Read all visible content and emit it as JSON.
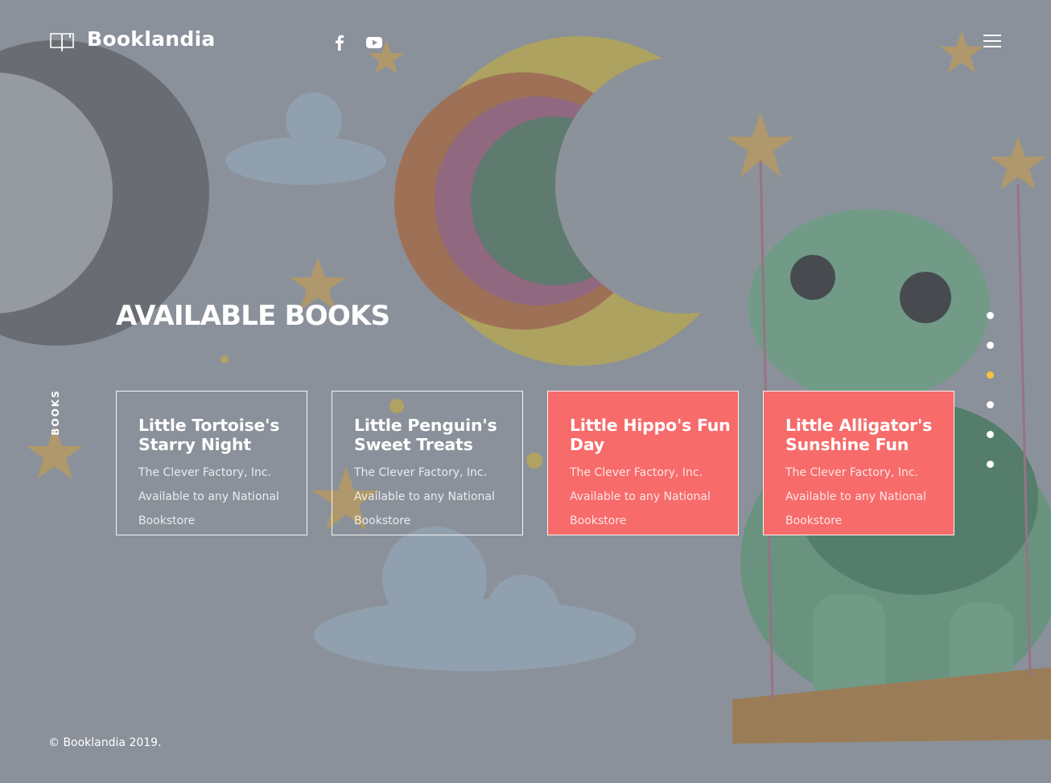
{
  "brand": {
    "name": "Booklandia",
    "icon": "open-book-icon"
  },
  "social": [
    {
      "name": "facebook",
      "icon": "facebook-icon"
    },
    {
      "name": "youtube",
      "icon": "youtube-icon"
    }
  ],
  "menu": {
    "icon": "hamburger-menu-icon"
  },
  "section": {
    "side_label": "BOOKS",
    "title": "AVAILABLE BOOKS"
  },
  "books": [
    {
      "title": "Little Tortoise's Starry Night",
      "publisher": "The Clever Factory, Inc.",
      "availability": "Available to any National Bookstore",
      "highlighted": false
    },
    {
      "title": "Little Penguin's Sweet Treats",
      "publisher": "The Clever Factory, Inc.",
      "availability": "Available to any National Bookstore",
      "highlighted": false
    },
    {
      "title": "Little Hippo's Fun Day",
      "publisher": "The Clever Factory, Inc.",
      "availability": "Available to any National Bookstore",
      "highlighted": true
    },
    {
      "title": "Little Alligator's Sunshine Fun",
      "publisher": "The Clever Factory, Inc.",
      "availability": "Available to any National Bookstore",
      "highlighted": true
    }
  ],
  "pagination": {
    "count": 6,
    "active_index": 2,
    "active_color": "#f7c23e"
  },
  "footer": {
    "copyright": "© Booklandia 2019."
  },
  "colors": {
    "card_highlight": "#f76b6b",
    "overlay": "#8e949b"
  }
}
